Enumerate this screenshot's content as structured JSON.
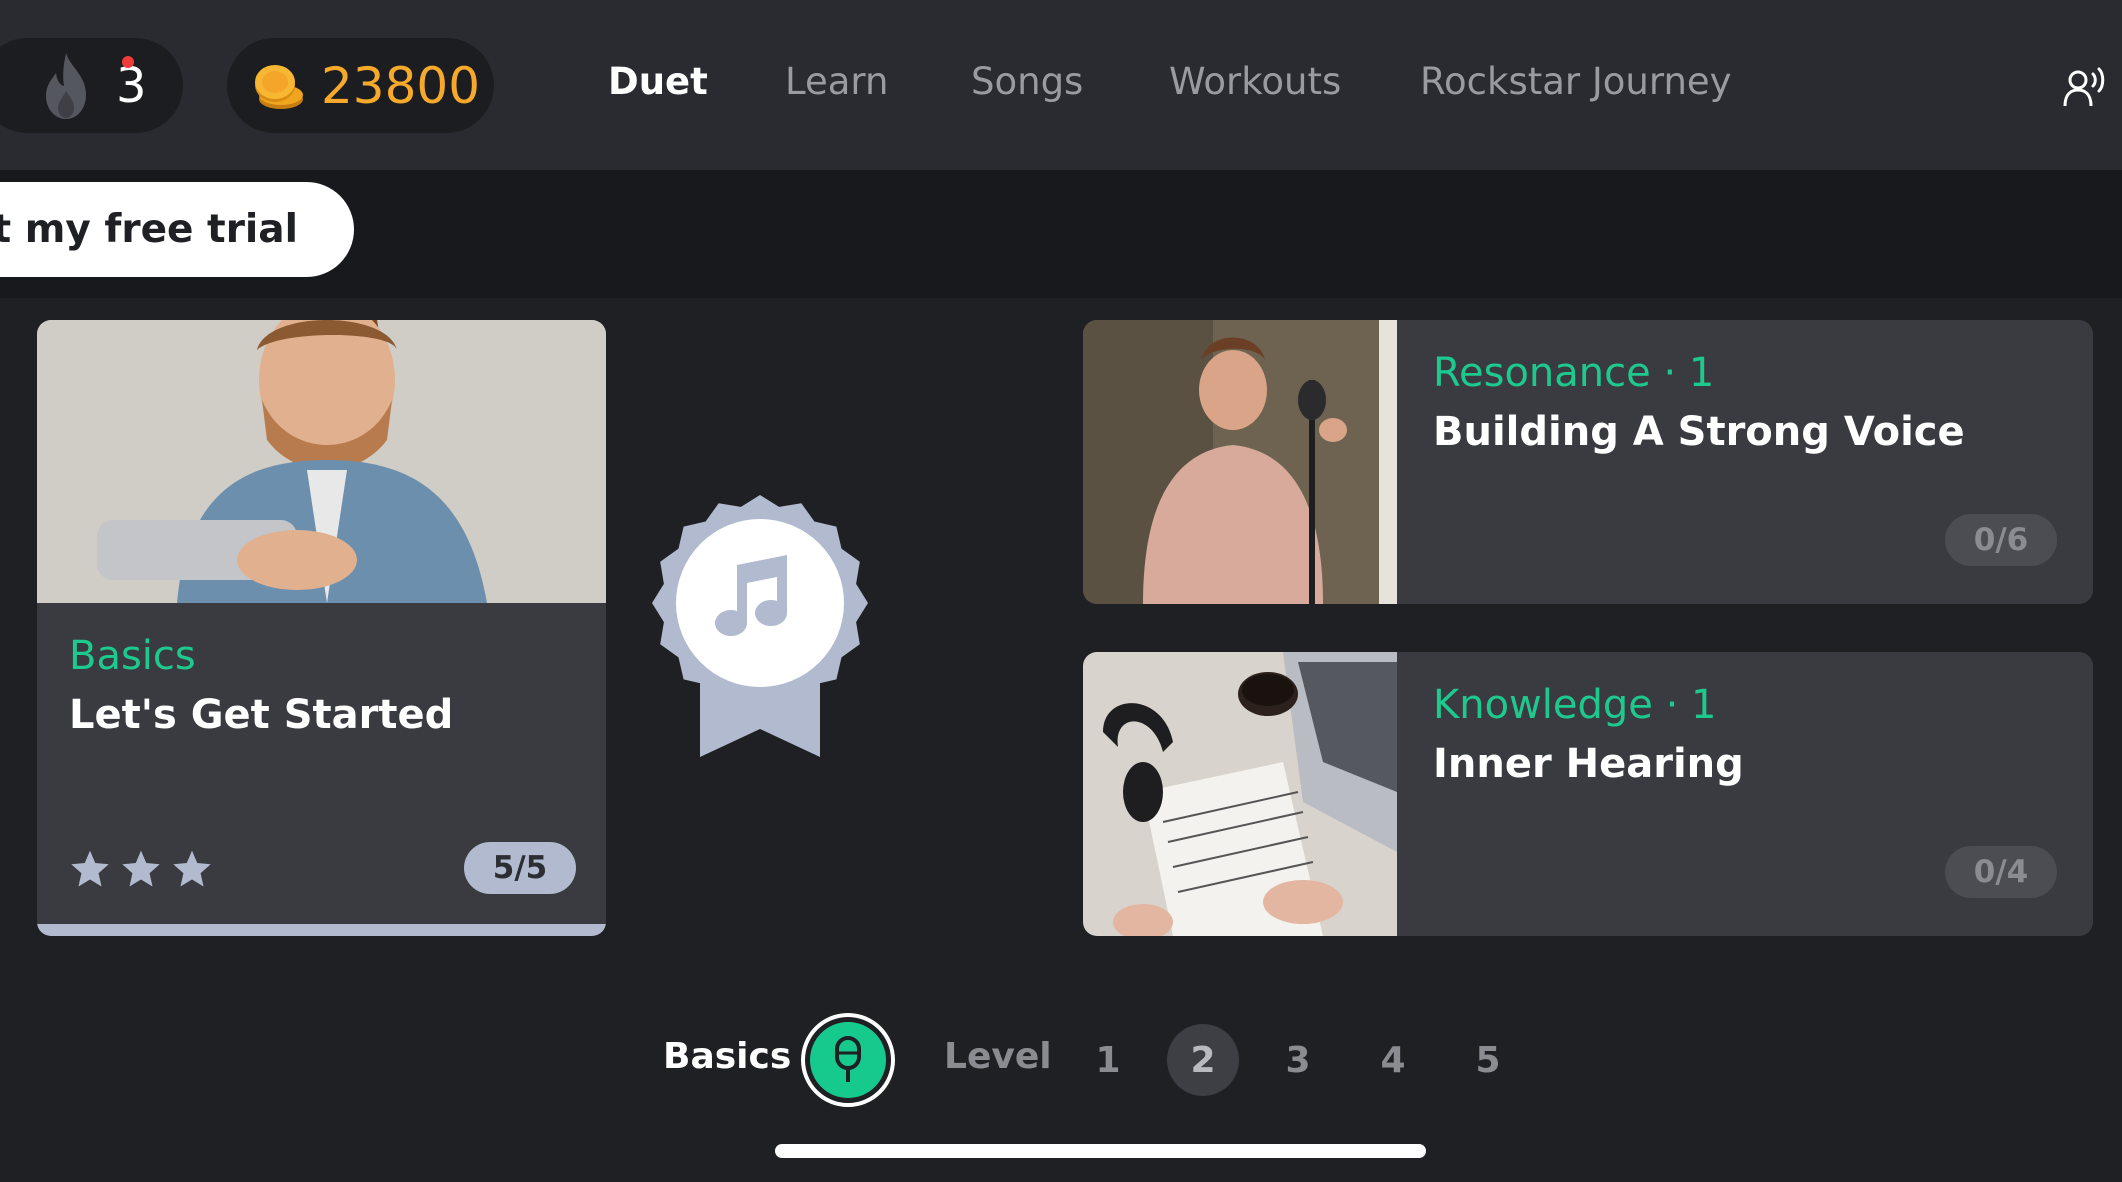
{
  "header": {
    "streak": "3",
    "coins": "23800",
    "nav": [
      {
        "label": "Duet",
        "active": true
      },
      {
        "label": "Learn",
        "active": false
      },
      {
        "label": "Songs",
        "active": false
      },
      {
        "label": "Workouts",
        "active": false
      },
      {
        "label": "Rockstar Journey",
        "active": false
      }
    ]
  },
  "trial": {
    "label": "Start my free trial"
  },
  "basics_card": {
    "category": "Basics",
    "title": "Let's Get Started",
    "stars": 3,
    "progress_label": "5/5",
    "progress_fraction": 1.0
  },
  "lessons": [
    {
      "category": "Resonance · 1",
      "title": "Building A Strong Voice",
      "progress_label": "0/6"
    },
    {
      "category": "Knowledge · 1",
      "title": "Inner Hearing",
      "progress_label": "0/4"
    }
  ],
  "level_selector": {
    "basics_label": "Basics",
    "level_label": "Level",
    "levels": [
      "1",
      "2",
      "3",
      "4",
      "5"
    ],
    "active_level": "2"
  },
  "colors": {
    "accent_green": "#1ec98f",
    "coin_orange": "#f7a92b",
    "badge_complete": "#b1bace"
  }
}
